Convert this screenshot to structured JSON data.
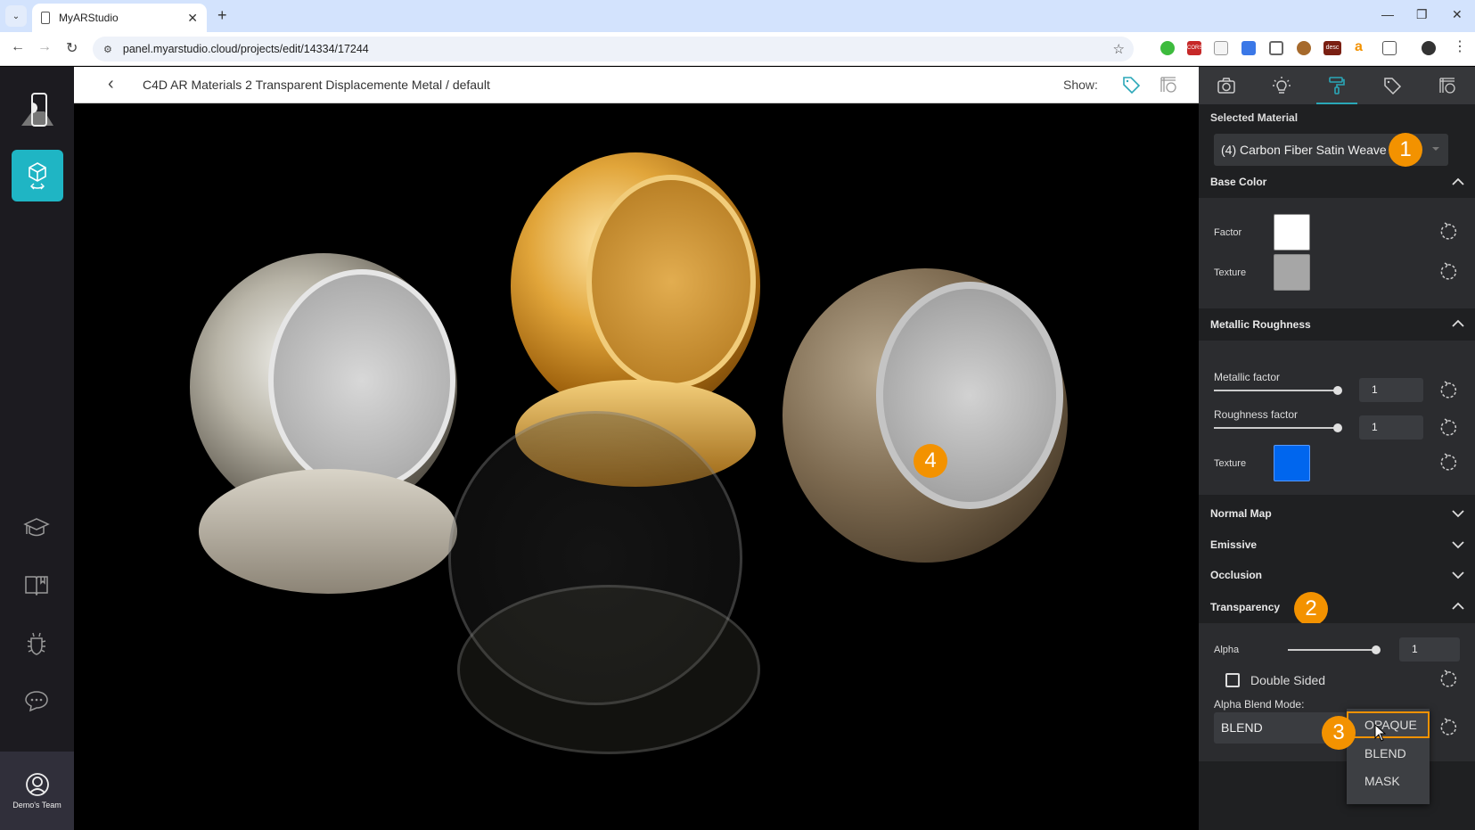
{
  "browser": {
    "tab_title": "MyARStudio",
    "url": "panel.myarstudio.cloud/projects/edit/14334/17244",
    "window_controls": [
      "minimize",
      "restore",
      "close"
    ],
    "extension_icons": [
      "green-hand-icon",
      "cors-icon",
      "envelope-icon",
      "translate-icon",
      "shield-icon",
      "pinecone-icon",
      "desc-icon",
      "amazon-icon",
      "puzzle-icon"
    ],
    "extension_labels": {
      "cors": "CORS",
      "desc": "desc",
      "amazon": "a"
    }
  },
  "sidebar": {
    "items": [
      "3d-model-editor",
      "academy",
      "documentation",
      "report-bug",
      "chat"
    ],
    "team_label": "Demo's Team"
  },
  "header": {
    "back_glyph": "‹",
    "title": "C4D AR Materials 2 Transparent Displacemente Metal / default",
    "show_label": "Show:"
  },
  "viewport": {
    "annotation_4": "4"
  },
  "panel": {
    "tabs": [
      {
        "name": "camera",
        "active": false
      },
      {
        "name": "lighting",
        "active": false
      },
      {
        "name": "materials",
        "active": true
      },
      {
        "name": "tags",
        "active": false
      },
      {
        "name": "model",
        "active": false
      }
    ],
    "selected_material_label": "Selected Material",
    "selected_material": "(4) Carbon Fiber Satin Weave",
    "annotation_1": "1",
    "base_color": {
      "title": "Base Color",
      "factor_label": "Factor",
      "factor_color": "#ffffff",
      "texture_label": "Texture",
      "texture_color": "#a6a6a6"
    },
    "metallic_roughness": {
      "title": "Metallic Roughness",
      "metallic_label": "Metallic factor",
      "metallic_value": "1",
      "metallic_fraction": 1,
      "roughness_label": "Roughness factor",
      "roughness_value": "1",
      "roughness_fraction": 1,
      "texture_label": "Texture",
      "texture_color": "#0066ee"
    },
    "collapsed_sections": [
      "Normal Map",
      "Emissive",
      "Occlusion"
    ],
    "transparency": {
      "title": "Transparency",
      "annotation_2": "2",
      "alpha_label": "Alpha",
      "alpha_value": "1",
      "alpha_fraction": 1,
      "double_sided_label": "Double Sided",
      "double_sided_checked": false,
      "blend_mode_label": "Alpha Blend Mode:",
      "blend_mode_value": "BLEND",
      "annotation_3": "3",
      "blend_options": [
        "OPAQUE",
        "BLEND",
        "MASK"
      ],
      "highlighted_option": "OPAQUE"
    }
  },
  "colors": {
    "accent": "#1fb5c4",
    "annotation": "#f39200",
    "panel_bg": "#1f2022"
  }
}
